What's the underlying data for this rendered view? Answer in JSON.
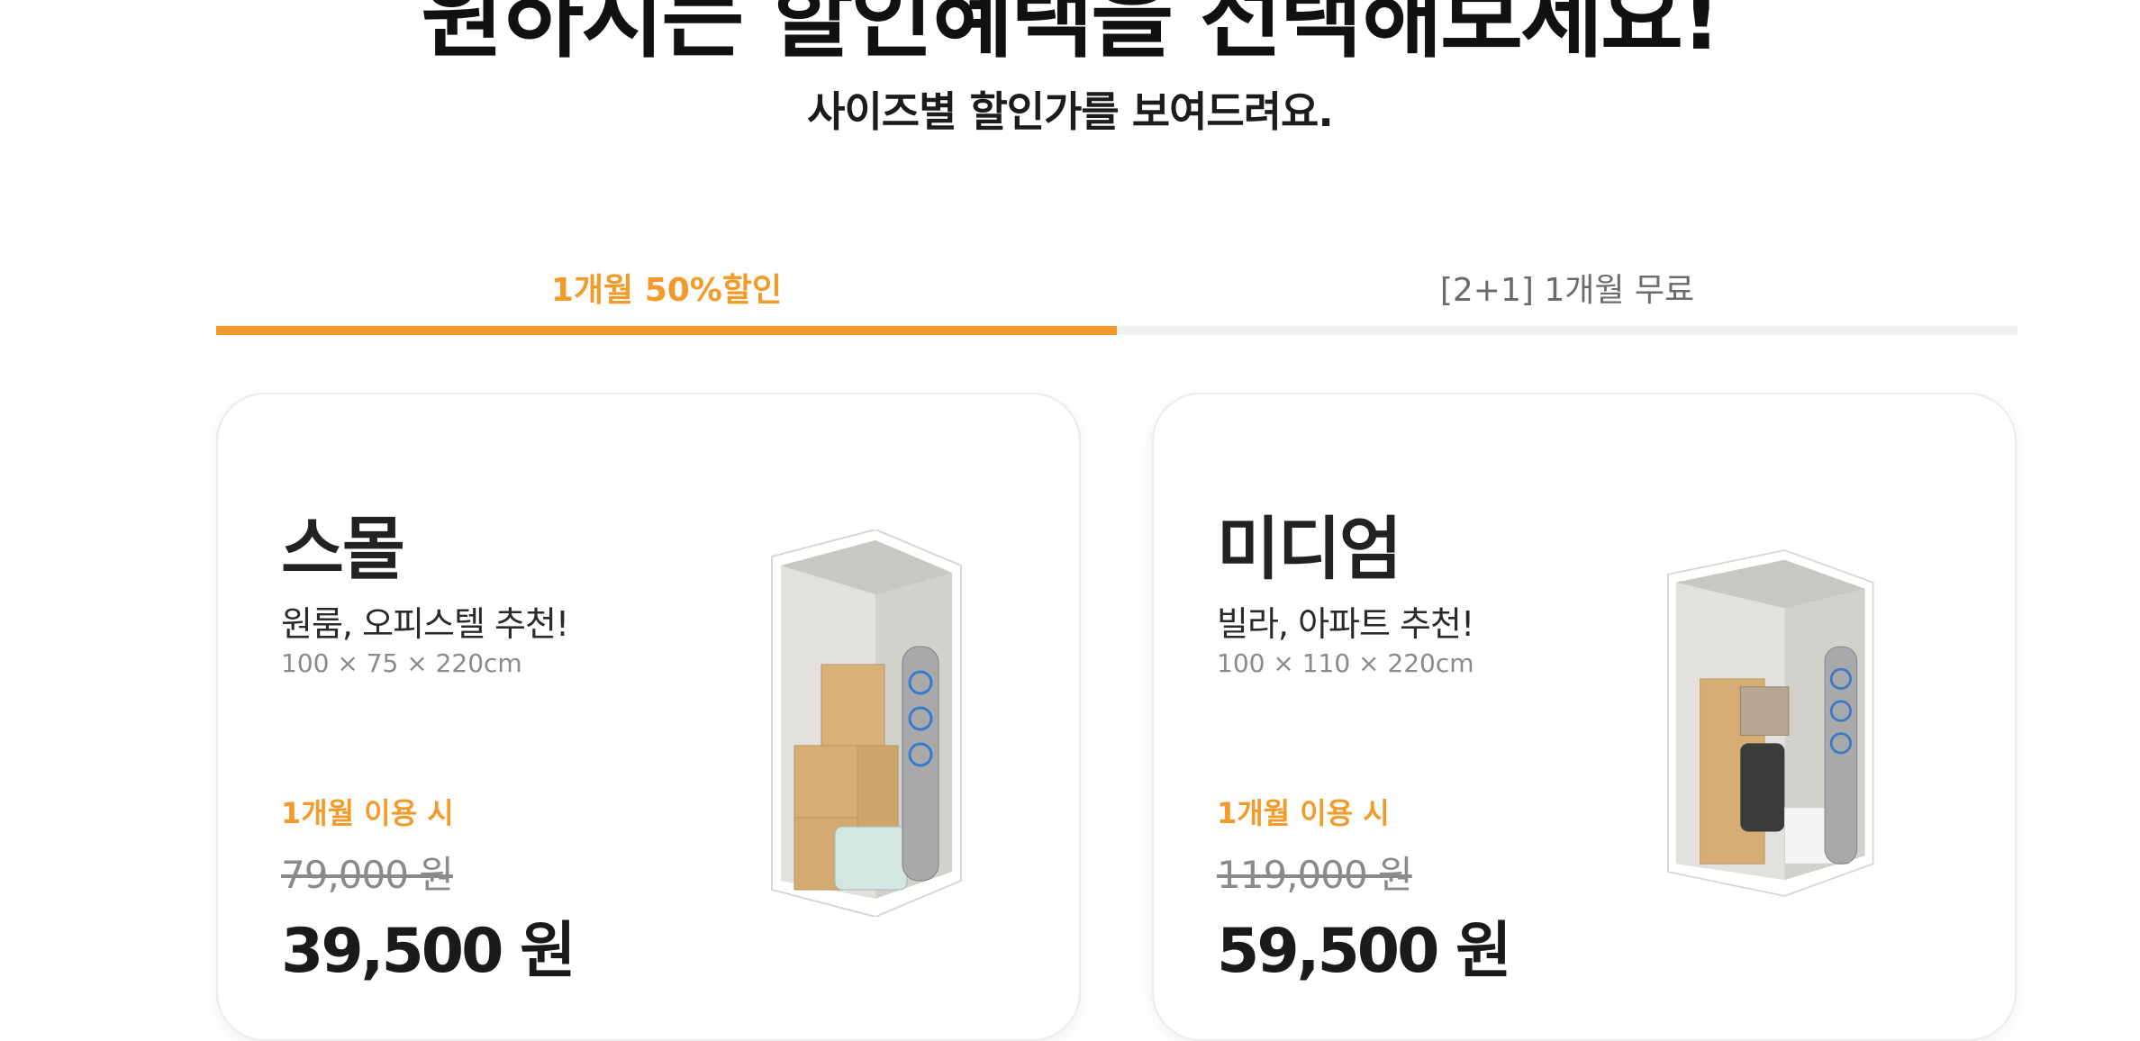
{
  "heading": "원하시는 할인혜택을 선택해보세요!",
  "subheading": "사이즈별 할인가를 보여드려요.",
  "tabs": [
    {
      "label": "1개월 50%할인",
      "active": true
    },
    {
      "label": "[2+1] 1개월 무료",
      "active": false
    }
  ],
  "colors": {
    "accent": "#f29b2b",
    "inactive_tab_bar": "#f1f1f1"
  },
  "cards": [
    {
      "title": "스몰",
      "description": "원룸, 오피스텔 추천!",
      "dimensions": "100 × 75 × 220cm",
      "period_label": "1개월 이용 시",
      "original_price": "79,000 원",
      "discount_price": "39,500 원",
      "image": "storage-unit-small-illustration"
    },
    {
      "title": "미디엄",
      "description": "빌라, 아파트 추천!",
      "dimensions": "100 × 110 × 220cm",
      "period_label": "1개월 이용 시",
      "original_price": "119,000 원",
      "discount_price": "59,500 원",
      "image": "storage-unit-medium-illustration"
    }
  ]
}
